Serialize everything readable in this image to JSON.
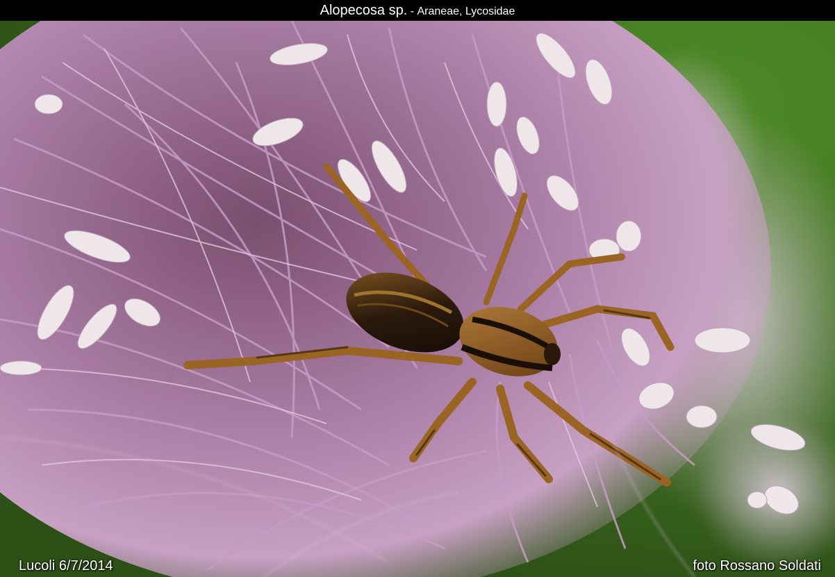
{
  "header": {
    "title": "Alopecosa sp.",
    "separator": " - ",
    "subtitle": "Araneae, Lycosidae"
  },
  "footer": {
    "location_date": "Lucoli 6/7/2014",
    "credit": "foto Rossano Soldati"
  },
  "photo": {
    "subject": "spider-on-flower",
    "colors": {
      "background_green": "#3f6e22",
      "flower_pink": "#b98ab5",
      "anther_white": "#efe6ea",
      "spider_brown": "#7a4a1c",
      "spider_dark": "#1b120a"
    }
  }
}
